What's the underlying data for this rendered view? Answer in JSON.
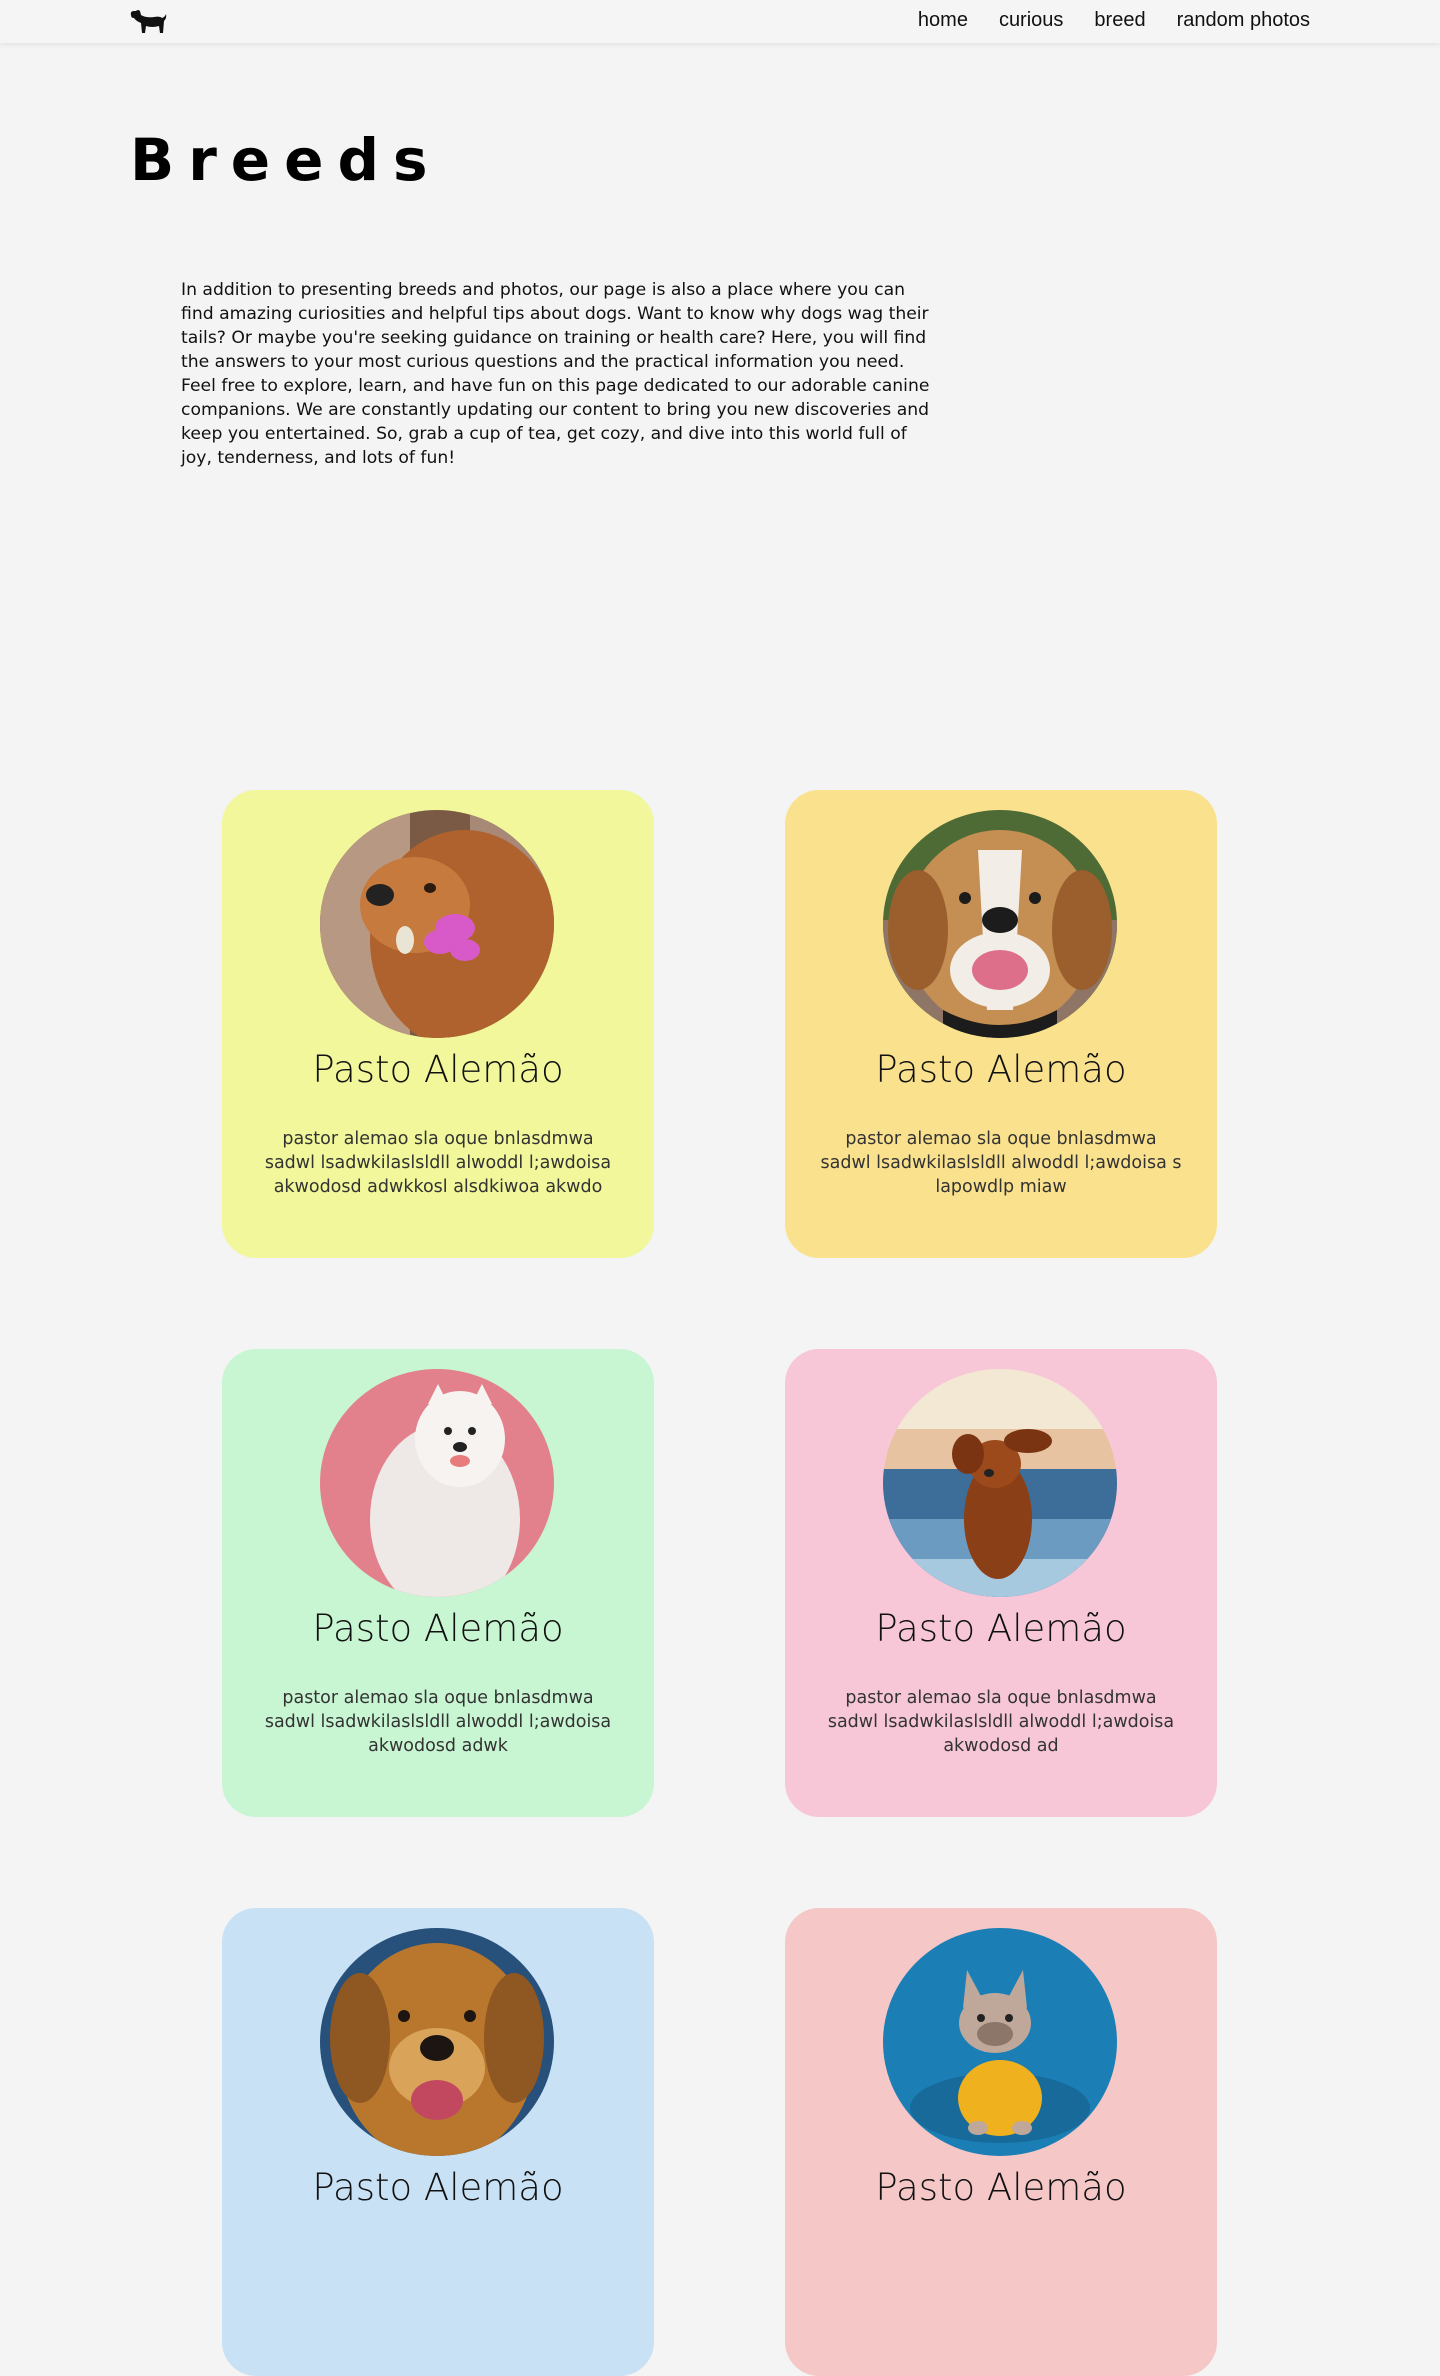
{
  "nav": {
    "logo_icon": "dog-silhouette-icon",
    "links": [
      "home",
      "curious",
      "breed",
      "random photos"
    ]
  },
  "page": {
    "title": "Breeds",
    "intro": [
      "In addition to presenting breeds and photos, our page is also a place where you can find amazing curiosities and helpful tips about dogs. Want to know why dogs wag their tails? Or maybe you're seeking guidance on training or health care? Here, you will find the answers to your most curious questions and the practical information you need.",
      "Feel free to explore, learn, and have fun on this page dedicated to our adorable canine companions. We are constantly updating our content to bring you new discoveries and keep you entertained. So, grab a cup of tea, get cozy, and dive into this world full of joy, tenderness, and lots of fun!"
    ]
  },
  "breeds": [
    {
      "name": "Pasto Alemão",
      "description": "pastor alemao sla oque bnlasdmwa sadwl lsadwkilaslsldll alwoddl l;awdoisa akwodosd adwkkosl alsdkiwoa akwdo",
      "bg": "#f1f79a",
      "photo": "golden-retriever-with-flower"
    },
    {
      "name": "Pasto Alemão",
      "description": "pastor alemao sla oque bnlasdmwa sadwl lsadwkilaslsldll alwoddl l;awdoisa s lapowdlp miaw",
      "bg": "#f9e18e",
      "photo": "smiling-beagle"
    },
    {
      "name": "Pasto Alemão",
      "description": "pastor alemao sla oque bnlasdmwa sadwl lsadwkilaslsldll alwoddl l;awdoisa akwodosd adwk",
      "bg": "#c8f5d2",
      "photo": "white-samoyed-on-pink"
    },
    {
      "name": "Pasto Alemão",
      "description": "pastor alemao sla oque bnlasdmwa sadwl lsadwkilaslsldll alwoddl l;awdoisa akwodosd ad",
      "bg": "#f7c7d8",
      "photo": "dog-running-at-beach"
    },
    {
      "name": "Pasto Alemão",
      "description": "",
      "bg": "#c8e1f5",
      "photo": "golden-retriever-on-blue"
    },
    {
      "name": "Pasto Alemão",
      "description": "",
      "bg": "#f5c7c7",
      "photo": "french-bulldog-in-yellow-shirt"
    }
  ]
}
